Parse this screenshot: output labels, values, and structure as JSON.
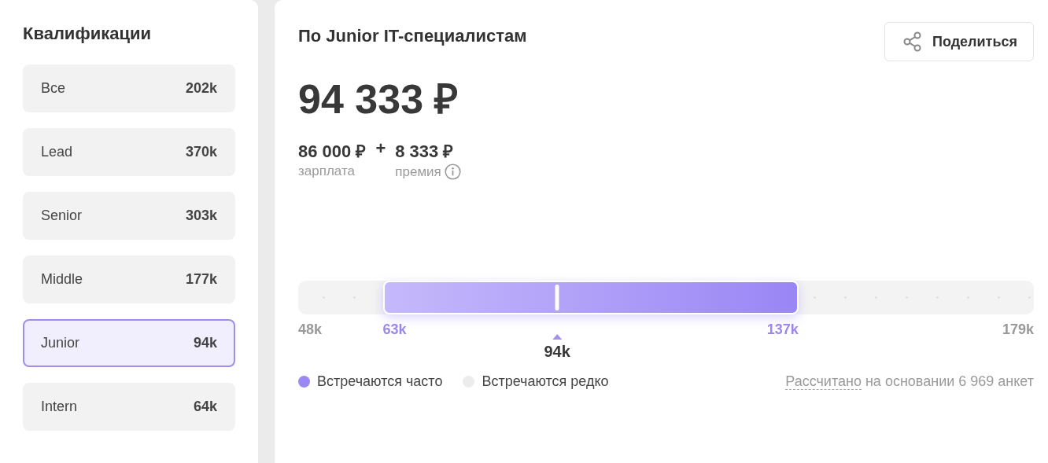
{
  "sidebar": {
    "title": "Квалификации",
    "items": [
      {
        "label": "Все",
        "value": "202k",
        "selected": false
      },
      {
        "label": "Lead",
        "value": "370k",
        "selected": false
      },
      {
        "label": "Senior",
        "value": "303k",
        "selected": false
      },
      {
        "label": "Middle",
        "value": "177k",
        "selected": false
      },
      {
        "label": "Junior",
        "value": "94k",
        "selected": true
      },
      {
        "label": "Intern",
        "value": "64k",
        "selected": false
      }
    ]
  },
  "main": {
    "title": "По Junior IT-специалистам",
    "share_button": "Поделиться",
    "total": "94 333 ₽",
    "parts": [
      {
        "amount": "86 000 ₽",
        "caption": "зарплата",
        "info": false
      },
      {
        "amount": "8 333 ₽",
        "caption": "премия",
        "info": true
      }
    ],
    "plus": "+",
    "range": {
      "median": {
        "level": 0.352,
        "label": "94k"
      },
      "scale_labels": [
        {
          "text": "48k",
          "kind": "min"
        },
        {
          "text": "63k",
          "kind": "low"
        },
        {
          "text": "137k",
          "kind": "high"
        },
        {
          "text": "179k",
          "kind": "max"
        }
      ]
    },
    "legend": [
      {
        "label": "Встречаются часто",
        "color": "#9c88f4"
      },
      {
        "label": "Встречаются редко",
        "color": "#ececec"
      }
    ],
    "note": {
      "link": "Рассчитано",
      "text": "на основании 6 969 анкет"
    }
  }
}
